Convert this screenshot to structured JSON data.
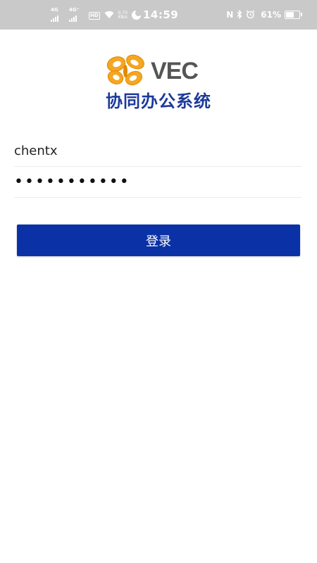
{
  "status_bar": {
    "sim1": "4G",
    "sim2": "4G⁺",
    "hd": "HD",
    "net_speed_value": "0.70",
    "net_speed_unit": "KB/s",
    "time": "14:59",
    "nfc": "N",
    "battery_text": "61%",
    "battery_level": 0.61
  },
  "logo": {
    "text": "VEC"
  },
  "app_title": "协同办公系统",
  "login_form": {
    "username": "chentx",
    "password_masked": "•••••••••••",
    "login_button": "登录"
  },
  "colors": {
    "primary": "#0b31a6",
    "title": "#1c3a9b",
    "logo_orange": "#f5a623",
    "logo_gray": "#555555",
    "status_bar_bg": "#c9c9c9"
  }
}
